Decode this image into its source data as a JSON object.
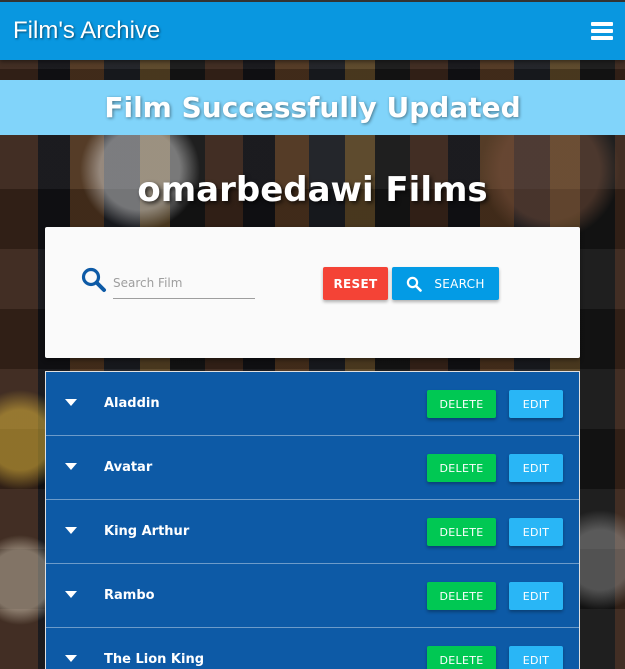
{
  "header": {
    "brand": "Film's Archive",
    "menu_icon": "hamburger-menu-icon"
  },
  "flash": {
    "message": "Film Successfully Updated"
  },
  "page": {
    "title": "omarbedawi Films"
  },
  "search": {
    "placeholder": "Search Film",
    "value": "",
    "icon": "search-icon",
    "reset_label": "RESET",
    "search_label": "SEARCH"
  },
  "films": [
    {
      "title": "Aladdin",
      "delete_label": "DELETE",
      "edit_label": "EDIT"
    },
    {
      "title": "Avatar",
      "delete_label": "DELETE",
      "edit_label": "EDIT"
    },
    {
      "title": "King Arthur",
      "delete_label": "DELETE",
      "edit_label": "EDIT"
    },
    {
      "title": "Rambo",
      "delete_label": "DELETE",
      "edit_label": "EDIT"
    },
    {
      "title": "The Lion King",
      "delete_label": "DELETE",
      "edit_label": "EDIT"
    }
  ],
  "colors": {
    "navbar": "#0997e0",
    "flash": "#81d4fa",
    "row": "#0d5aa6",
    "reset": "#f44336",
    "search": "#039be5",
    "delete": "#00c853",
    "edit": "#29b6f6"
  }
}
